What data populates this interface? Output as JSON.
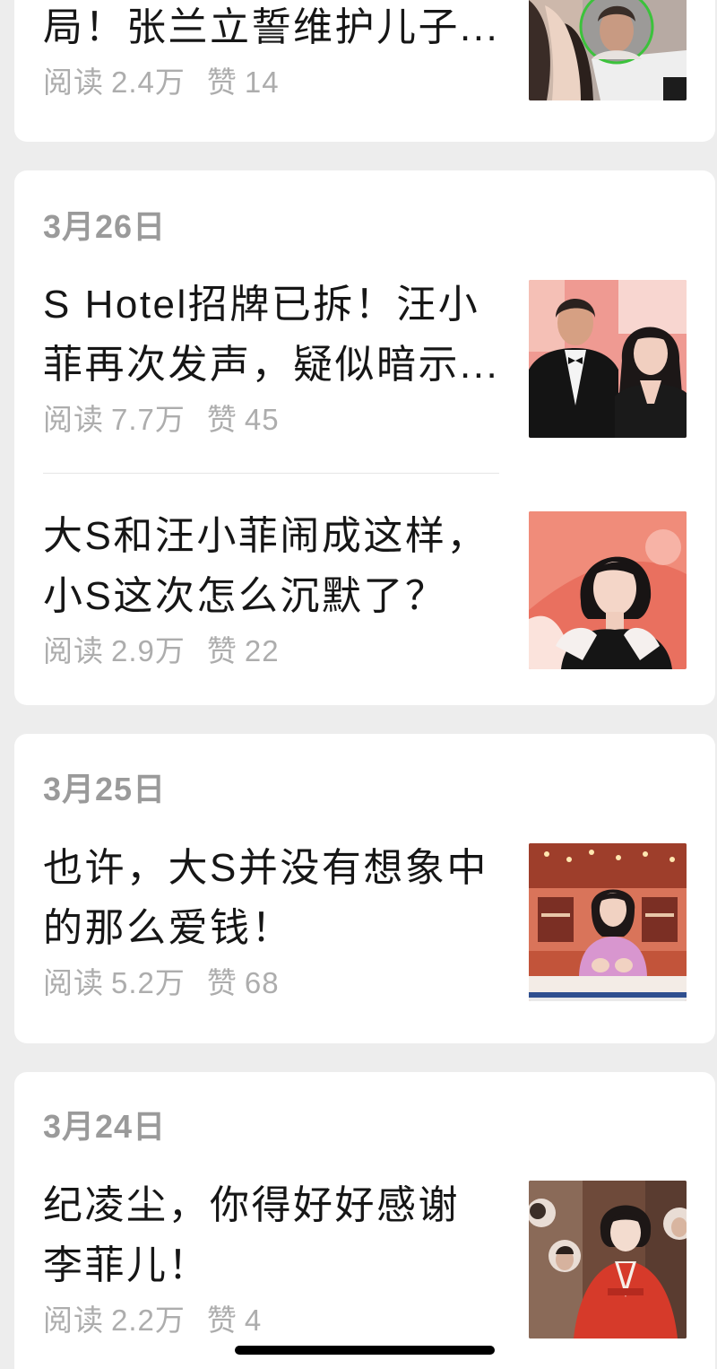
{
  "colors": {
    "bg": "#ededed",
    "card": "#ffffff",
    "title": "#161616",
    "meta": "#adadad",
    "date": "#9a9a9a",
    "divider": "#e6e6e6",
    "home_indicator": "#000000"
  },
  "groups": [
    {
      "date": null,
      "articles": [
        {
          "title_lines": [
            "局！张兰立誓维护儿子..."
          ],
          "read_label": "阅读",
          "reads": "2.4万",
          "like_label": "赞",
          "likes": "14"
        }
      ]
    },
    {
      "date": "3月26日",
      "articles": [
        {
          "title_lines": [
            "S Hotel招牌已拆！汪小",
            "菲再次发声，疑似暗示..."
          ],
          "read_label": "阅读",
          "reads": "7.7万",
          "like_label": "赞",
          "likes": "45"
        },
        {
          "title_lines": [
            "大S和汪小菲闹成这样，",
            "小S这次怎么沉默了？"
          ],
          "read_label": "阅读",
          "reads": "2.9万",
          "like_label": "赞",
          "likes": "22"
        }
      ]
    },
    {
      "date": "3月25日",
      "articles": [
        {
          "title_lines": [
            "也许，大S并没有想象中",
            "的那么爱钱！"
          ],
          "read_label": "阅读",
          "reads": "5.2万",
          "like_label": "赞",
          "likes": "68"
        }
      ]
    },
    {
      "date": "3月24日",
      "articles": [
        {
          "title_lines": [
            "纪凌尘，你得好好感谢",
            "李菲儿！"
          ],
          "read_label": "阅读",
          "reads": "2.2万",
          "like_label": "赞",
          "likes": "4"
        }
      ]
    }
  ]
}
